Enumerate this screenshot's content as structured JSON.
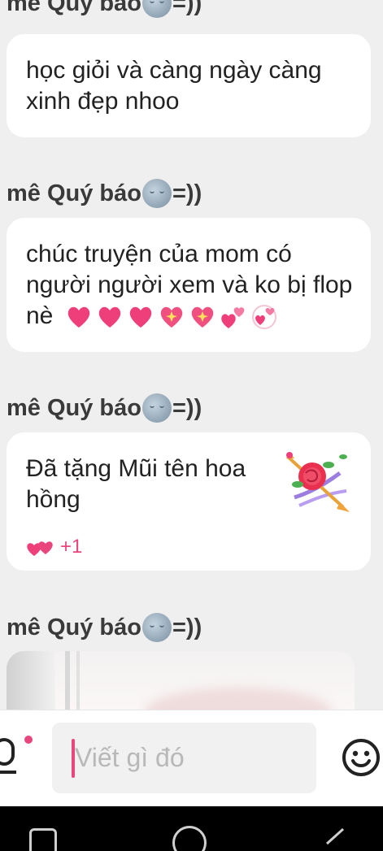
{
  "messages": [
    {
      "sender": "mê Quý báo",
      "sender_suffix": "=))",
      "text": "học giỏi và càng ngày càng xinh đẹp nhoo"
    },
    {
      "sender": "mê Quý báo",
      "sender_suffix": "=))",
      "text": "chúc truyện của mom có người người xem và ko bị flop nè"
    },
    {
      "sender": "mê Quý báo",
      "sender_suffix": "=))",
      "text": "Đã tặng Mũi tên hoa hồng",
      "reaction_count": "+1"
    },
    {
      "sender": "mê Quý báo",
      "sender_suffix": "=))"
    }
  ],
  "input": {
    "placeholder": "Viết gì đó"
  },
  "colors": {
    "accent": "#e8467c",
    "bubble": "#ffffff",
    "background": "#efefef",
    "nav": "#000000"
  },
  "icons": [
    "moon-face-emoji",
    "heart-emoji",
    "sparkling-heart-emoji",
    "two-hearts-emoji",
    "rose-arrow-gift",
    "two-hearts-reaction",
    "microphone-icon",
    "emoji-icon",
    "recent-apps-icon",
    "home-icon",
    "back-icon"
  ]
}
